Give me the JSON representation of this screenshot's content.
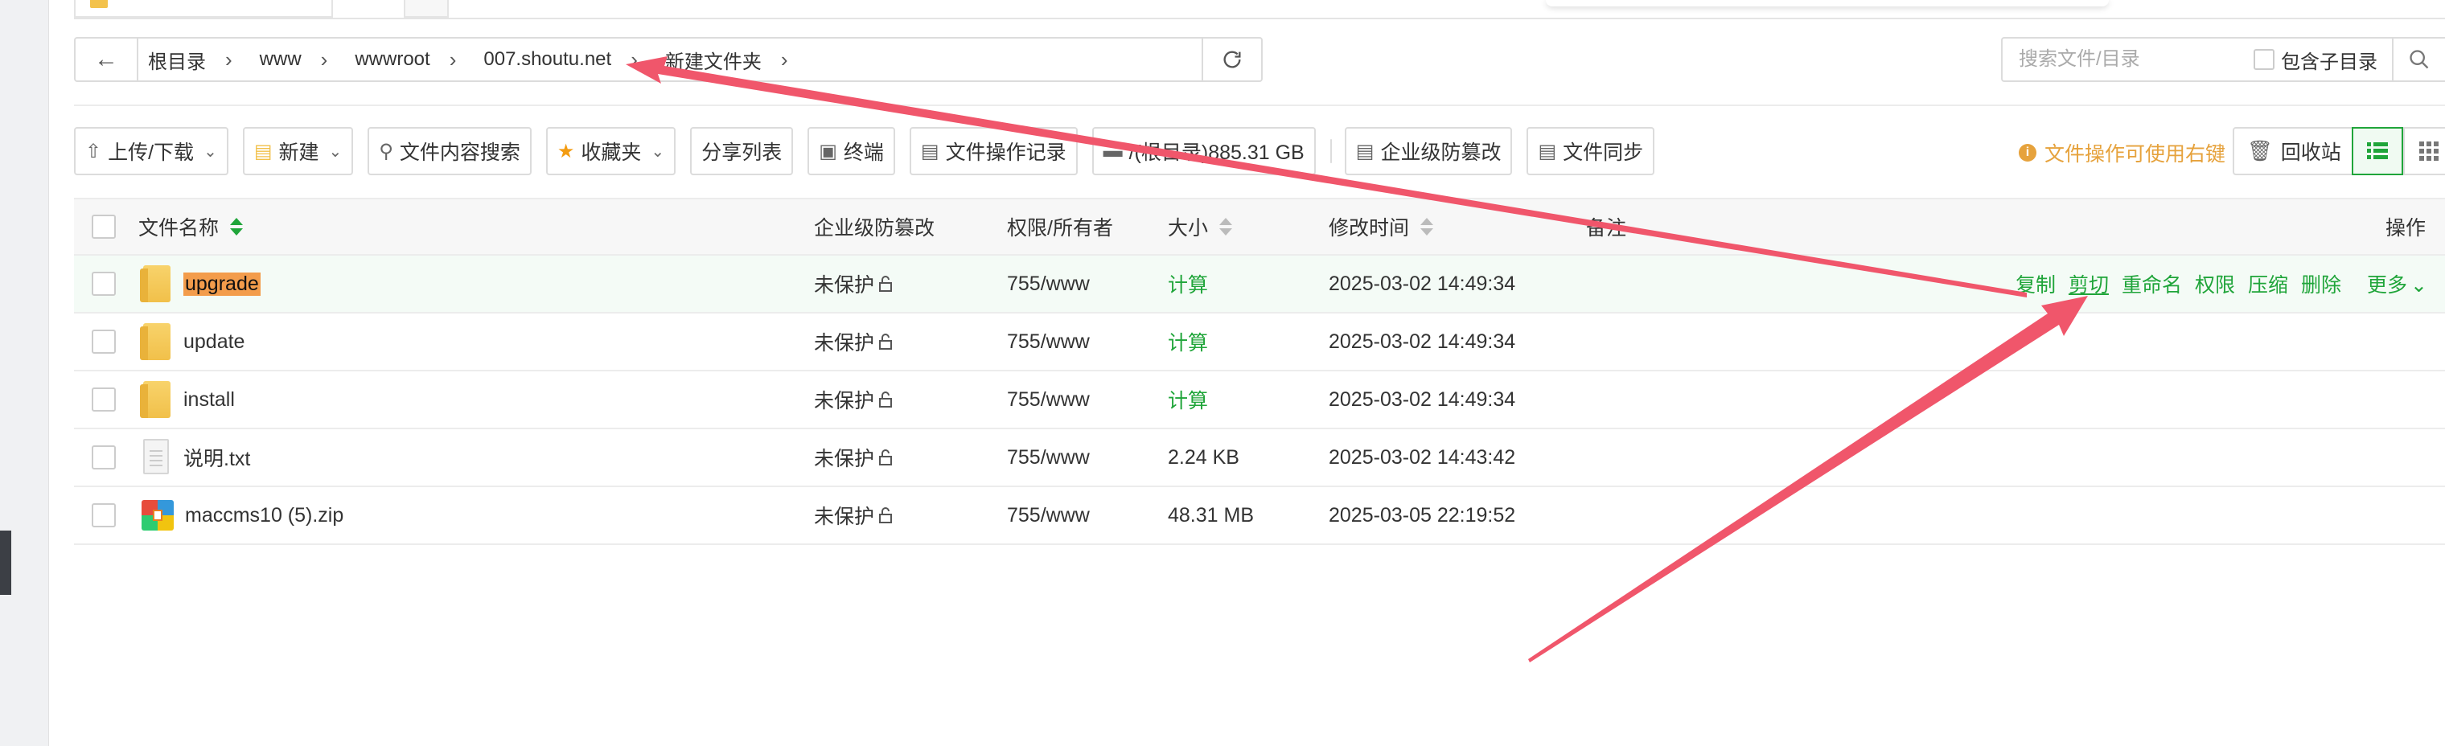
{
  "path_bar": {
    "crumbs": [
      "根目录",
      "www",
      "wwwroot",
      "007.shoutu.net",
      "新建文件夹"
    ]
  },
  "search": {
    "placeholder": "搜索文件/目录",
    "include_subdir_label": "包含子目录"
  },
  "toolbar": {
    "upload_download": "上传/下载",
    "new": "新建",
    "content_search": "文件内容搜索",
    "favorites": "收藏夹",
    "share_list": "分享列表",
    "terminal": "终端",
    "operation_log": "文件操作记录",
    "disk": "/(根目录)885.31 GB",
    "tamper_proof": "企业级防篡改",
    "file_sync": "文件同步",
    "tip": "文件操作可使用右键",
    "recycle_bin": "回收站"
  },
  "table": {
    "headers": {
      "name": "文件名称",
      "tamper": "企业级防篡改",
      "perm": "权限/所有者",
      "size": "大小",
      "mtime": "修改时间",
      "note": "备注",
      "ops": "操作"
    },
    "rows": [
      {
        "name": "upgrade",
        "type": "folder",
        "tamper": "未保护",
        "perm": "755/www",
        "size": "计算",
        "mtime": "2025-03-02 14:49:34"
      },
      {
        "name": "update",
        "type": "folder",
        "tamper": "未保护",
        "perm": "755/www",
        "size": "计算",
        "mtime": "2025-03-02 14:49:34"
      },
      {
        "name": "install",
        "type": "folder",
        "tamper": "未保护",
        "perm": "755/www",
        "size": "计算",
        "mtime": "2025-03-02 14:49:34"
      },
      {
        "name": "说明.txt",
        "type": "txt",
        "tamper": "未保护",
        "perm": "755/www",
        "size": "2.24 KB",
        "mtime": "2025-03-02 14:43:42"
      },
      {
        "name": "maccms10 (5).zip",
        "type": "zip",
        "tamper": "未保护",
        "perm": "755/www",
        "size": "48.31 MB",
        "mtime": "2025-03-05 22:19:52"
      }
    ],
    "row_ops": [
      "复制",
      "剪切",
      "重命名",
      "权限",
      "压缩",
      "删除",
      "更多"
    ]
  },
  "colors": {
    "accent_green": "#20a53a",
    "warning_orange": "#e6a23c",
    "annotation_red": "#f0566b",
    "selection_orange": "#f39c4b"
  }
}
